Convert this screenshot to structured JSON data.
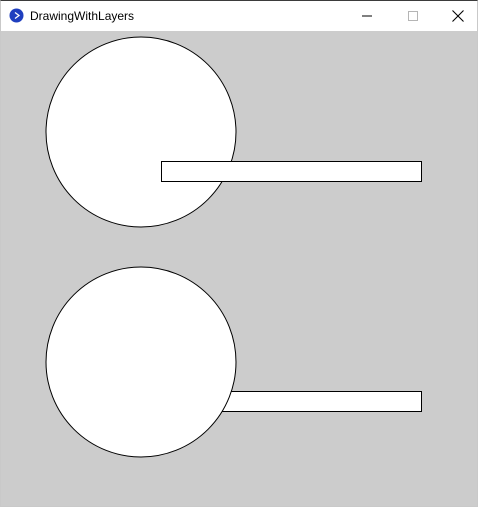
{
  "window": {
    "title": "DrawingWithLayers",
    "app_icon": "processing-app-icon",
    "controls": {
      "minimize": "minimize-icon",
      "maximize": "maximize-icon",
      "close": "close-icon"
    }
  },
  "canvas": {
    "background": "#cccccc",
    "shape_fill": "#ffffff",
    "stroke": "#000000",
    "icon_color": "#1f3fbf"
  }
}
